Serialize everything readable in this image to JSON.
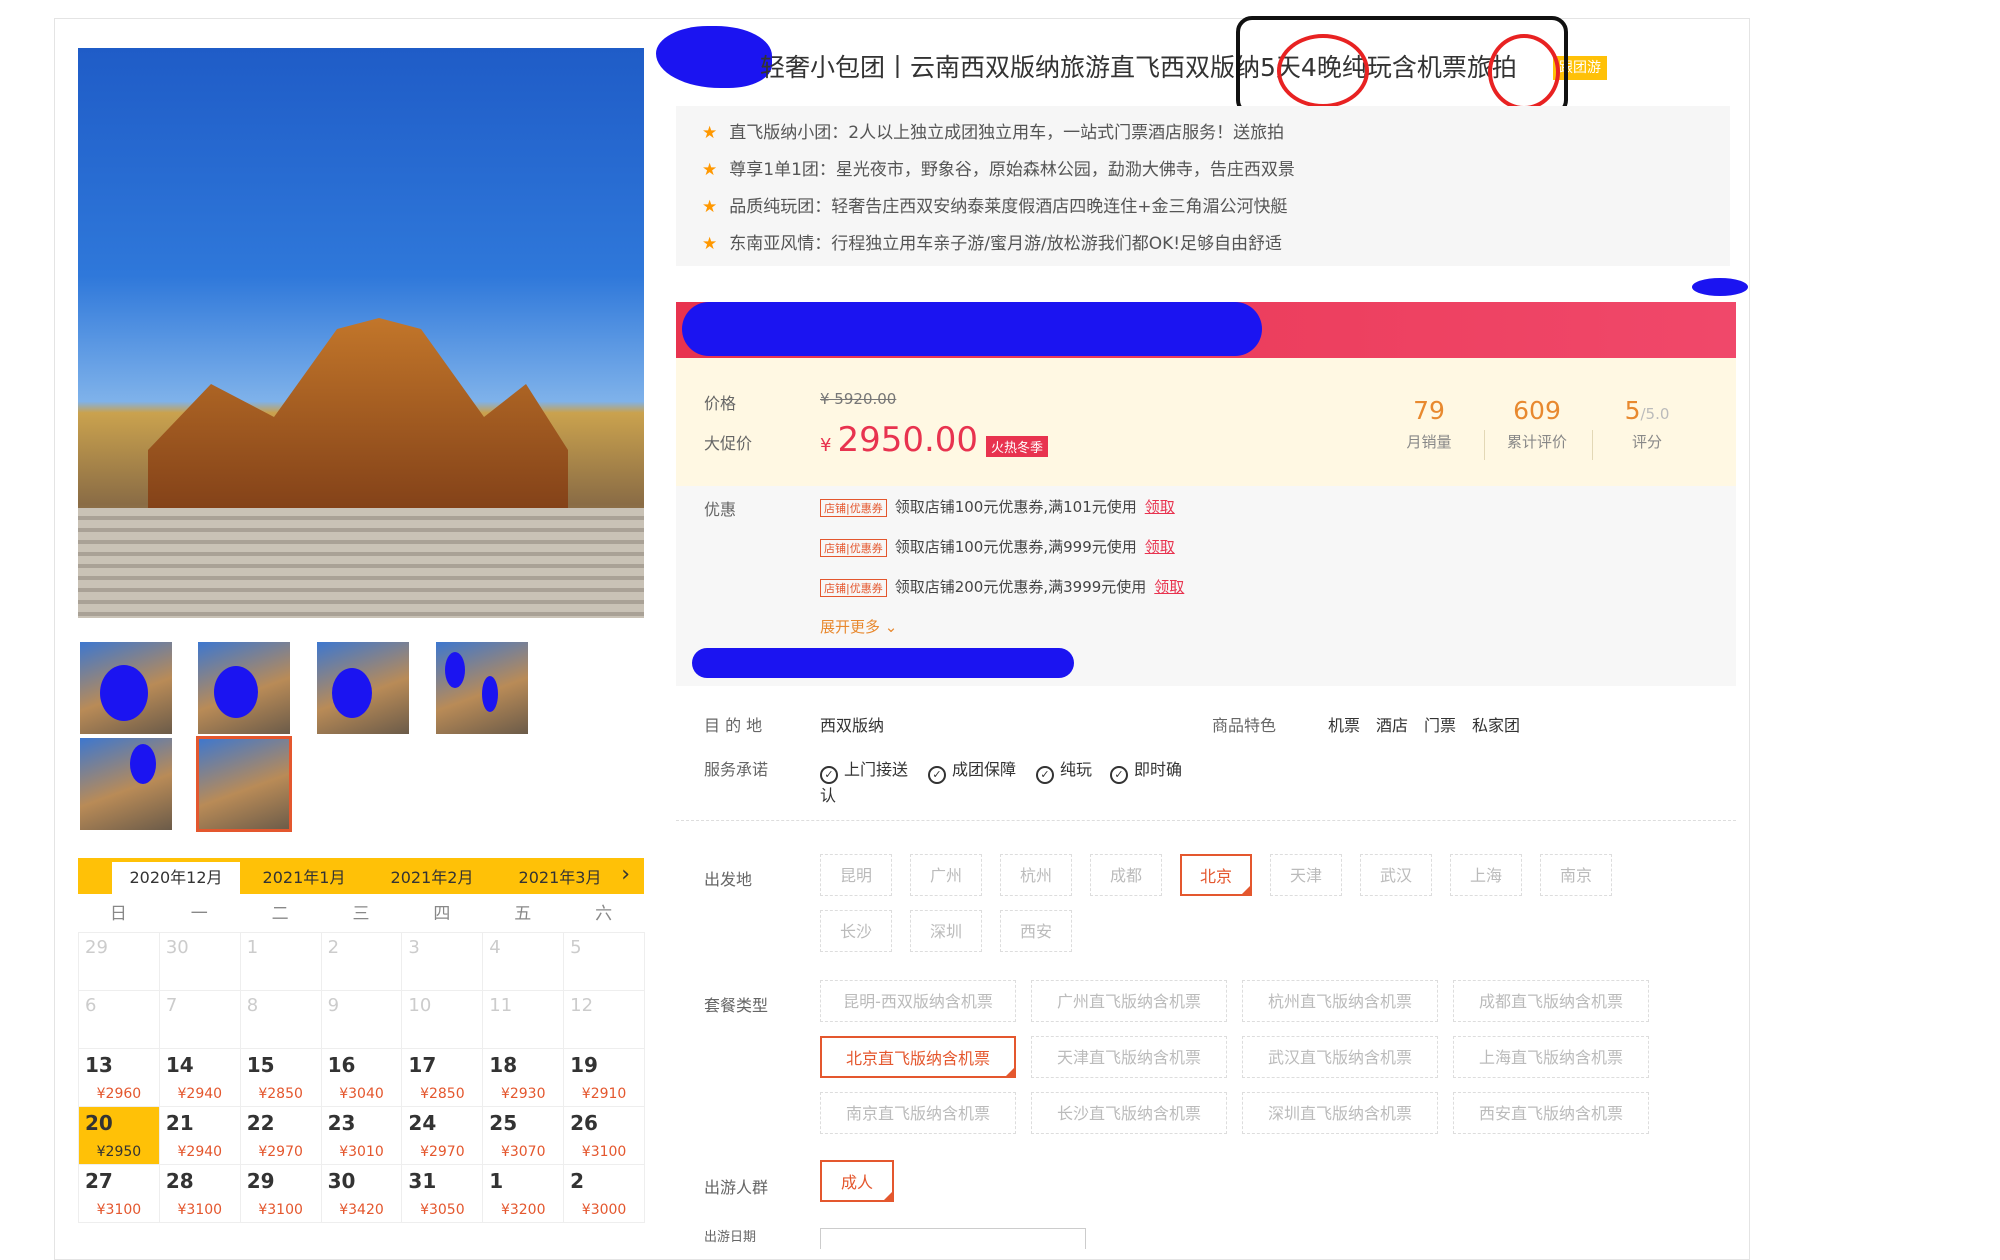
{
  "product": {
    "title": "轻奢小包团丨云南西双版纳旅游直飞西双版纳5天4晚纯玩含机票旅拍",
    "tag": "跟团游",
    "features": [
      "直飞版纳小团：2人以上独立成团独立用车，一站式门票酒店服务！送旅拍",
      "尊享1单1团：星光夜市，野象谷，原始森林公园，勐泐大佛寺，告庄西双景",
      "品质纯玩团：轻奢告庄西双安纳泰莱度假酒店四晚连住+金三角湄公河快艇",
      "东南亚风情：行程独立用车亲子游/蜜月游/放松游我们都OK!足够自由舒适"
    ]
  },
  "pricing": {
    "price_label": "价格",
    "original_price": "¥ 5920.00",
    "promo_label": "大促价",
    "currency": "¥",
    "promo_price": "2950.00",
    "promo_tag": "火热冬季",
    "stats": [
      {
        "value": "79",
        "suffix": "",
        "label": "月销量"
      },
      {
        "value": "609",
        "suffix": "",
        "label": "累计评价"
      },
      {
        "value": "5",
        "suffix": "/5.0",
        "label": "评分"
      }
    ]
  },
  "coupons": {
    "label": "优惠",
    "badge": "店铺|优惠券",
    "claim": "领取",
    "items": [
      "领取店铺100元优惠券,满101元使用",
      "领取店铺100元优惠券,满999元使用",
      "领取店铺200元优惠券,满3999元使用"
    ],
    "more": "展开更多 ⌄"
  },
  "info": {
    "destination_label": "目 的 地",
    "destination": "西双版纳",
    "features_label": "商品特色",
    "features": [
      "机票",
      "酒店",
      "门票",
      "私家团"
    ],
    "service_label": "服务承诺",
    "services": [
      "上门接送",
      "成团保障",
      "纯玩",
      "即时确"
    ],
    "service_wrap": "认"
  },
  "options": {
    "departure_label": "出发地",
    "departures": [
      "昆明",
      "广州",
      "杭州",
      "成都",
      "北京",
      "天津",
      "武汉",
      "上海",
      "南京",
      "长沙",
      "深圳",
      "西安"
    ],
    "departure_selected": "北京",
    "package_label": "套餐类型",
    "packages": [
      "昆明-西双版纳含机票",
      "广州直飞版纳含机票",
      "杭州直飞版纳含机票",
      "成都直飞版纳含机票",
      "北京直飞版纳含机票",
      "天津直飞版纳含机票",
      "武汉直飞版纳含机票",
      "上海直飞版纳含机票",
      "南京直飞版纳含机票",
      "长沙直飞版纳含机票",
      "深圳直飞版纳含机票",
      "西安直飞版纳含机票"
    ],
    "package_selected": "北京直飞版纳含机票",
    "traveler_label": "出游人群",
    "traveler": "成人",
    "date_label": "出游日期"
  },
  "calendar": {
    "months": [
      "2020年12月",
      "2021年1月",
      "2021年2月",
      "2021年3月"
    ],
    "active_month": "2020年12月",
    "next_icon": "chevron-right-icon",
    "weekdays": [
      "日",
      "一",
      "二",
      "三",
      "四",
      "五",
      "六"
    ],
    "rows": [
      [
        {
          "d": "29",
          "p": ""
        },
        {
          "d": "30",
          "p": ""
        },
        {
          "d": "1",
          "p": ""
        },
        {
          "d": "2",
          "p": ""
        },
        {
          "d": "3",
          "p": ""
        },
        {
          "d": "4",
          "p": ""
        },
        {
          "d": "5",
          "p": ""
        }
      ],
      [
        {
          "d": "6",
          "p": ""
        },
        {
          "d": "7",
          "p": ""
        },
        {
          "d": "8",
          "p": ""
        },
        {
          "d": "9",
          "p": ""
        },
        {
          "d": "10",
          "p": ""
        },
        {
          "d": "11",
          "p": ""
        },
        {
          "d": "12",
          "p": ""
        }
      ],
      [
        {
          "d": "13",
          "p": "¥2960"
        },
        {
          "d": "14",
          "p": "¥2940"
        },
        {
          "d": "15",
          "p": "¥2850"
        },
        {
          "d": "16",
          "p": "¥3040"
        },
        {
          "d": "17",
          "p": "¥2850"
        },
        {
          "d": "18",
          "p": "¥2930"
        },
        {
          "d": "19",
          "p": "¥2910"
        }
      ],
      [
        {
          "d": "20",
          "p": "¥2950"
        },
        {
          "d": "21",
          "p": "¥2940"
        },
        {
          "d": "22",
          "p": "¥2970"
        },
        {
          "d": "23",
          "p": "¥3010"
        },
        {
          "d": "24",
          "p": "¥2970"
        },
        {
          "d": "25",
          "p": "¥3070"
        },
        {
          "d": "26",
          "p": "¥3100"
        }
      ],
      [
        {
          "d": "27",
          "p": "¥3100"
        },
        {
          "d": "28",
          "p": "¥3100"
        },
        {
          "d": "29",
          "p": "¥3100"
        },
        {
          "d": "30",
          "p": "¥3420"
        },
        {
          "d": "31",
          "p": "¥3050"
        },
        {
          "d": "1",
          "p": "¥3200"
        },
        {
          "d": "2",
          "p": "¥3000"
        }
      ]
    ],
    "today": "20"
  },
  "colors": {
    "accent": "#e4572e",
    "price": "#e8334f",
    "calendar_bar": "#ffc107",
    "redaction": "#1b14f1",
    "annotation_circle": "#e82222"
  }
}
